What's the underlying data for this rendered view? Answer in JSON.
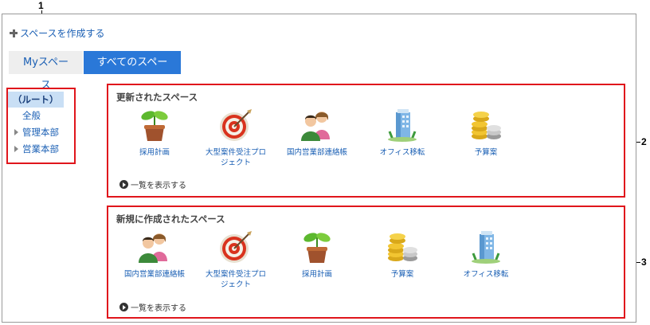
{
  "callouts": [
    "1",
    "2",
    "3"
  ],
  "create_link": "スペースを作成する",
  "tabs": {
    "my": "Myスペース",
    "all": "すべてのスペース"
  },
  "tree": {
    "root": "（ルート）",
    "general": "全般",
    "admin": "管理本部",
    "sales": "営業本部"
  },
  "updated": {
    "title": "更新されたスペース",
    "items": [
      {
        "label": "採用計画",
        "icon": "plant-icon"
      },
      {
        "label": "大型案件受注プロジェクト",
        "icon": "target-icon"
      },
      {
        "label": "国内営業部連絡帳",
        "icon": "people-icon"
      },
      {
        "label": "オフィス移転",
        "icon": "building-icon"
      },
      {
        "label": "予算案",
        "icon": "coins-icon"
      }
    ],
    "show_all": "一覧を表示する"
  },
  "created": {
    "title": "新規に作成されたスペース",
    "items": [
      {
        "label": "国内営業部連絡帳",
        "icon": "people-icon"
      },
      {
        "label": "大型案件受注プロジェクト",
        "icon": "target-icon"
      },
      {
        "label": "採用計画",
        "icon": "plant-icon"
      },
      {
        "label": "予算案",
        "icon": "coins-icon"
      },
      {
        "label": "オフィス移転",
        "icon": "building-icon"
      }
    ],
    "show_all": "一覧を表示する"
  },
  "colors": {
    "highlight": "#e0161c",
    "link": "#1a5fb4",
    "active_tab": "#2a78d8"
  }
}
